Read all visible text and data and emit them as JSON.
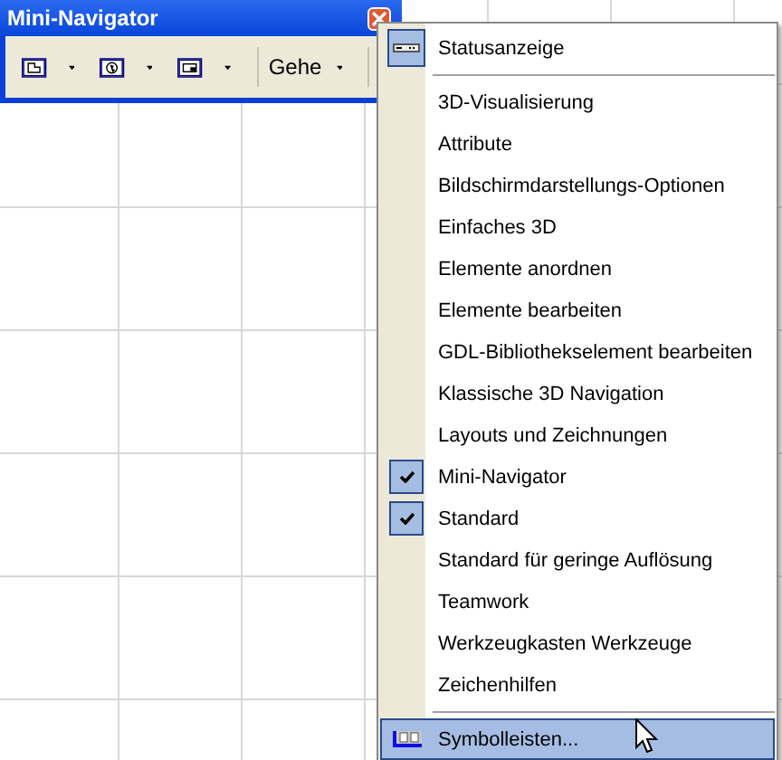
{
  "window": {
    "title": "Mini-Navigator",
    "goto_label": "Gehe"
  },
  "menu": {
    "items": [
      {
        "kind": "icon-item",
        "label": "Statusanzeige",
        "checked": false,
        "highlighted": false
      },
      {
        "kind": "separator"
      },
      {
        "kind": "item",
        "label": "3D-Visualisierung",
        "checked": false,
        "highlighted": false
      },
      {
        "kind": "item",
        "label": "Attribute",
        "checked": false,
        "highlighted": false
      },
      {
        "kind": "item",
        "label": "Bildschirmdarstellungs-Optionen",
        "checked": false,
        "highlighted": false
      },
      {
        "kind": "item",
        "label": "Einfaches 3D",
        "checked": false,
        "highlighted": false
      },
      {
        "kind": "item",
        "label": "Elemente anordnen",
        "checked": false,
        "highlighted": false
      },
      {
        "kind": "item",
        "label": "Elemente bearbeiten",
        "checked": false,
        "highlighted": false
      },
      {
        "kind": "item",
        "label": "GDL-Bibliothekselement bearbeiten",
        "checked": false,
        "highlighted": false
      },
      {
        "kind": "item",
        "label": "Klassische 3D Navigation",
        "checked": false,
        "highlighted": false
      },
      {
        "kind": "item",
        "label": "Layouts und Zeichnungen",
        "checked": false,
        "highlighted": false
      },
      {
        "kind": "item",
        "label": "Mini-Navigator",
        "checked": true,
        "highlighted": false
      },
      {
        "kind": "item",
        "label": "Standard",
        "checked": true,
        "highlighted": false
      },
      {
        "kind": "item",
        "label": "Standard für geringe Auflösung",
        "checked": false,
        "highlighted": false
      },
      {
        "kind": "item",
        "label": "Teamwork",
        "checked": false,
        "highlighted": false
      },
      {
        "kind": "item",
        "label": "Werkzeugkasten Werkzeuge",
        "checked": false,
        "highlighted": false
      },
      {
        "kind": "item",
        "label": "Zeichenhilfen",
        "checked": false,
        "highlighted": false
      },
      {
        "kind": "separator"
      },
      {
        "kind": "toolbar-item",
        "label": "Symbolleisten...",
        "checked": false,
        "highlighted": true
      }
    ]
  }
}
